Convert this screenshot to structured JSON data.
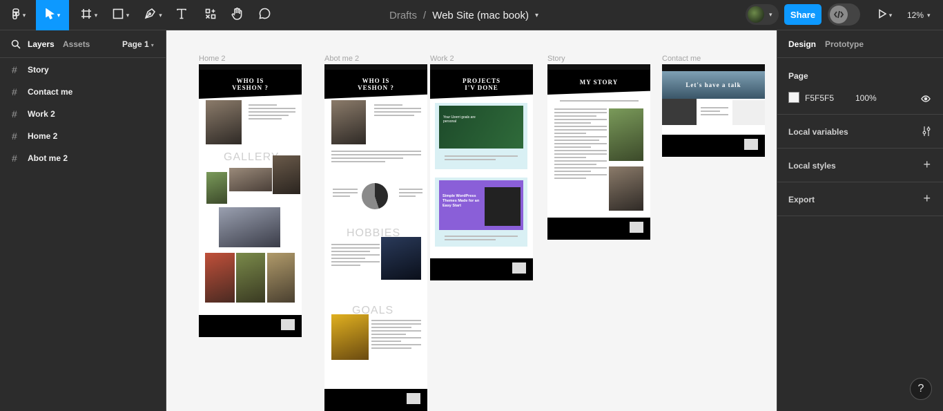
{
  "toolbar": {
    "file_crumb": "Drafts",
    "separator": "/",
    "file_name": "Web Site (mac book)",
    "share_label": "Share",
    "zoom_level": "12%",
    "tools": [
      "figma-menu-icon",
      "move-tool-icon",
      "frame-tool-icon",
      "shape-tool-icon",
      "pen-tool-icon",
      "text-tool-icon",
      "resources-icon",
      "hand-tool-icon",
      "comment-icon"
    ]
  },
  "left_panel": {
    "tab_layers": "Layers",
    "tab_assets": "Assets",
    "page_selector": "Page 1",
    "layers": [
      {
        "name": "Story"
      },
      {
        "name": "Contact me"
      },
      {
        "name": "Work 2"
      },
      {
        "name": "Home 2"
      },
      {
        "name": "Abot me 2"
      }
    ]
  },
  "canvas": {
    "background": "#F5F5F5",
    "frames": [
      {
        "label": "Home 2",
        "hero": "WHO IS\nVESHON ?",
        "words": [
          "GALLERY"
        ]
      },
      {
        "label": "Abot me 2",
        "hero": "WHO IS\nVESHON ?",
        "words": [
          "HOBBIES",
          "GOALS"
        ]
      },
      {
        "label": "Work 2",
        "hero": "PROJECTS\nI'V  DONE",
        "promo1": "Your Uzerri goals are personal",
        "promo2": "Simple WordPress Themes Made for an Easy Start"
      },
      {
        "label": "Story",
        "hero": "MY  STORY"
      },
      {
        "label": "Contact me",
        "hero": "Let's have a talk"
      }
    ]
  },
  "right_panel": {
    "tab_design": "Design",
    "tab_prototype": "Prototype",
    "page_heading": "Page",
    "page_color": "F5F5F5",
    "page_opacity": "100%",
    "local_variables": "Local variables",
    "local_styles": "Local styles",
    "export": "Export"
  },
  "help_label": "?",
  "colors": {
    "accent": "#0D99FF",
    "panel": "#2C2C2C",
    "canvas": "#F5F5F5"
  }
}
